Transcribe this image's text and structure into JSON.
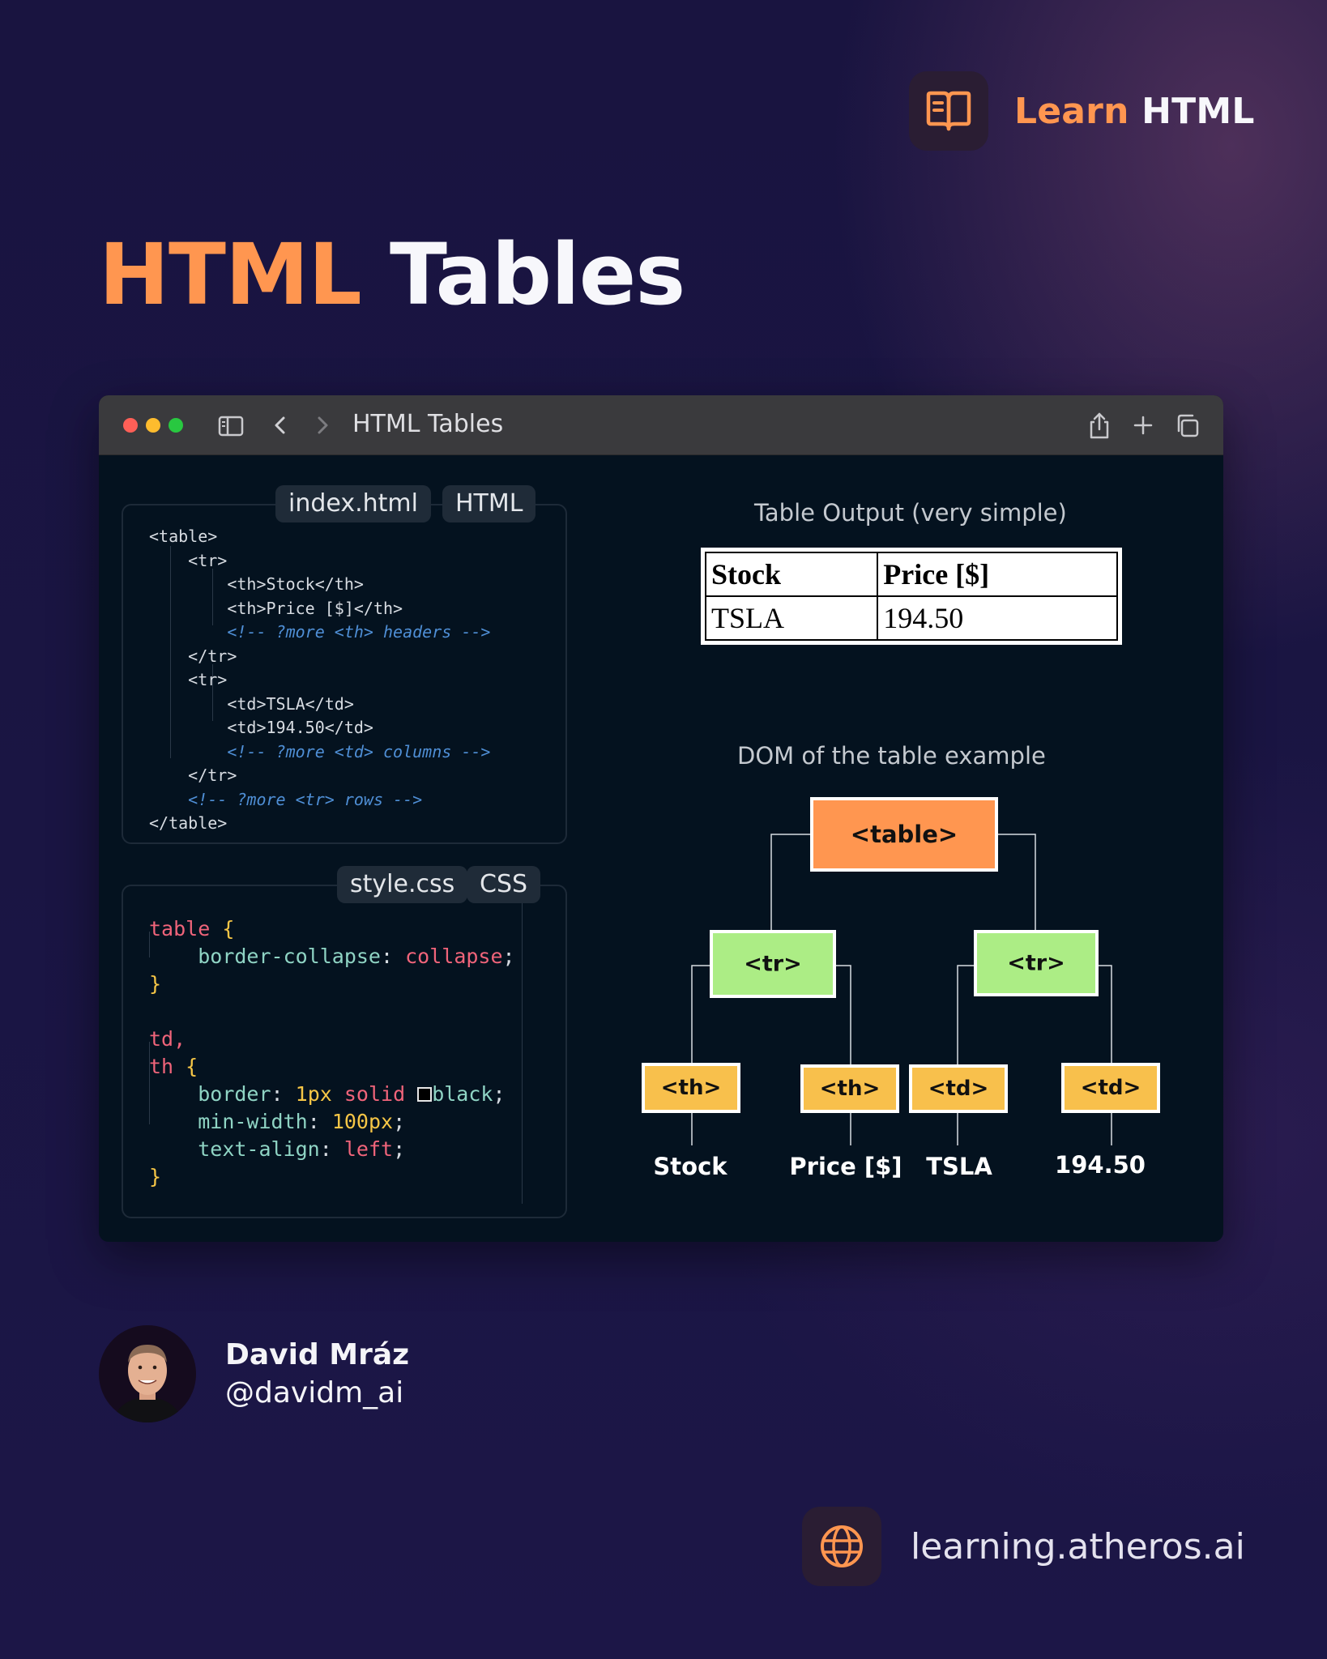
{
  "brand": {
    "learn": "Learn",
    "html": "HTML",
    "icon": "book-icon"
  },
  "title": {
    "highlight": "HTML",
    "rest": "Tables"
  },
  "browser": {
    "tab_title": "HTML Tables",
    "icons": [
      "traffic-lights",
      "sidebar-icon",
      "back-icon",
      "forward-icon",
      "share-icon",
      "plus-icon",
      "tabs-icon"
    ]
  },
  "html_panel": {
    "filename": "index.html",
    "language": "HTML",
    "lines": [
      "<table>",
      "    <tr>",
      "        <th>Stock</th>",
      "        <th>Price [$]</th>",
      "        <!-- ?more <th> headers -->",
      "    </tr>",
      "    <tr>",
      "        <td>TSLA</td>",
      "        <td>194.50</td>",
      "        <!-- ?more <td> columns -->",
      "    </tr>",
      "    <!-- ?more <tr> rows -->",
      "</table>"
    ]
  },
  "css_panel": {
    "filename": "style.css",
    "language": "CSS",
    "selector1": "table",
    "open_brace": "{",
    "close_brace": "}",
    "prop_collapse": "border-collapse",
    "val_collapse": "collapse",
    "selector2a": "td,",
    "selector2b": "th",
    "prop_border": "border",
    "val_border_num": "1px",
    "val_border_style": "solid",
    "val_border_color": "black",
    "prop_minwidth": "min-width",
    "val_minwidth": "100px",
    "prop_align": "text-align",
    "val_align": "left",
    "colon": ":",
    "semicolon": ";"
  },
  "table_output": {
    "label": "Table Output (very simple)",
    "headers": [
      "Stock",
      "Price [$]"
    ],
    "rows": [
      [
        "TSLA",
        "194.50"
      ]
    ]
  },
  "dom": {
    "label": "DOM of the table example",
    "root": "<table>",
    "tr": "<tr>",
    "th": "<th>",
    "td": "<td>",
    "leaves": [
      "Stock",
      "Price [$]",
      "TSLA",
      "194.50"
    ],
    "colors": {
      "table": "#ff9650",
      "tr": "#aced85",
      "cell": "#f8c04c"
    }
  },
  "author": {
    "name": "David Mráz",
    "handle": "@davidm_ai"
  },
  "footer": {
    "url": "learning.atheros.ai",
    "icon": "globe-icon"
  }
}
